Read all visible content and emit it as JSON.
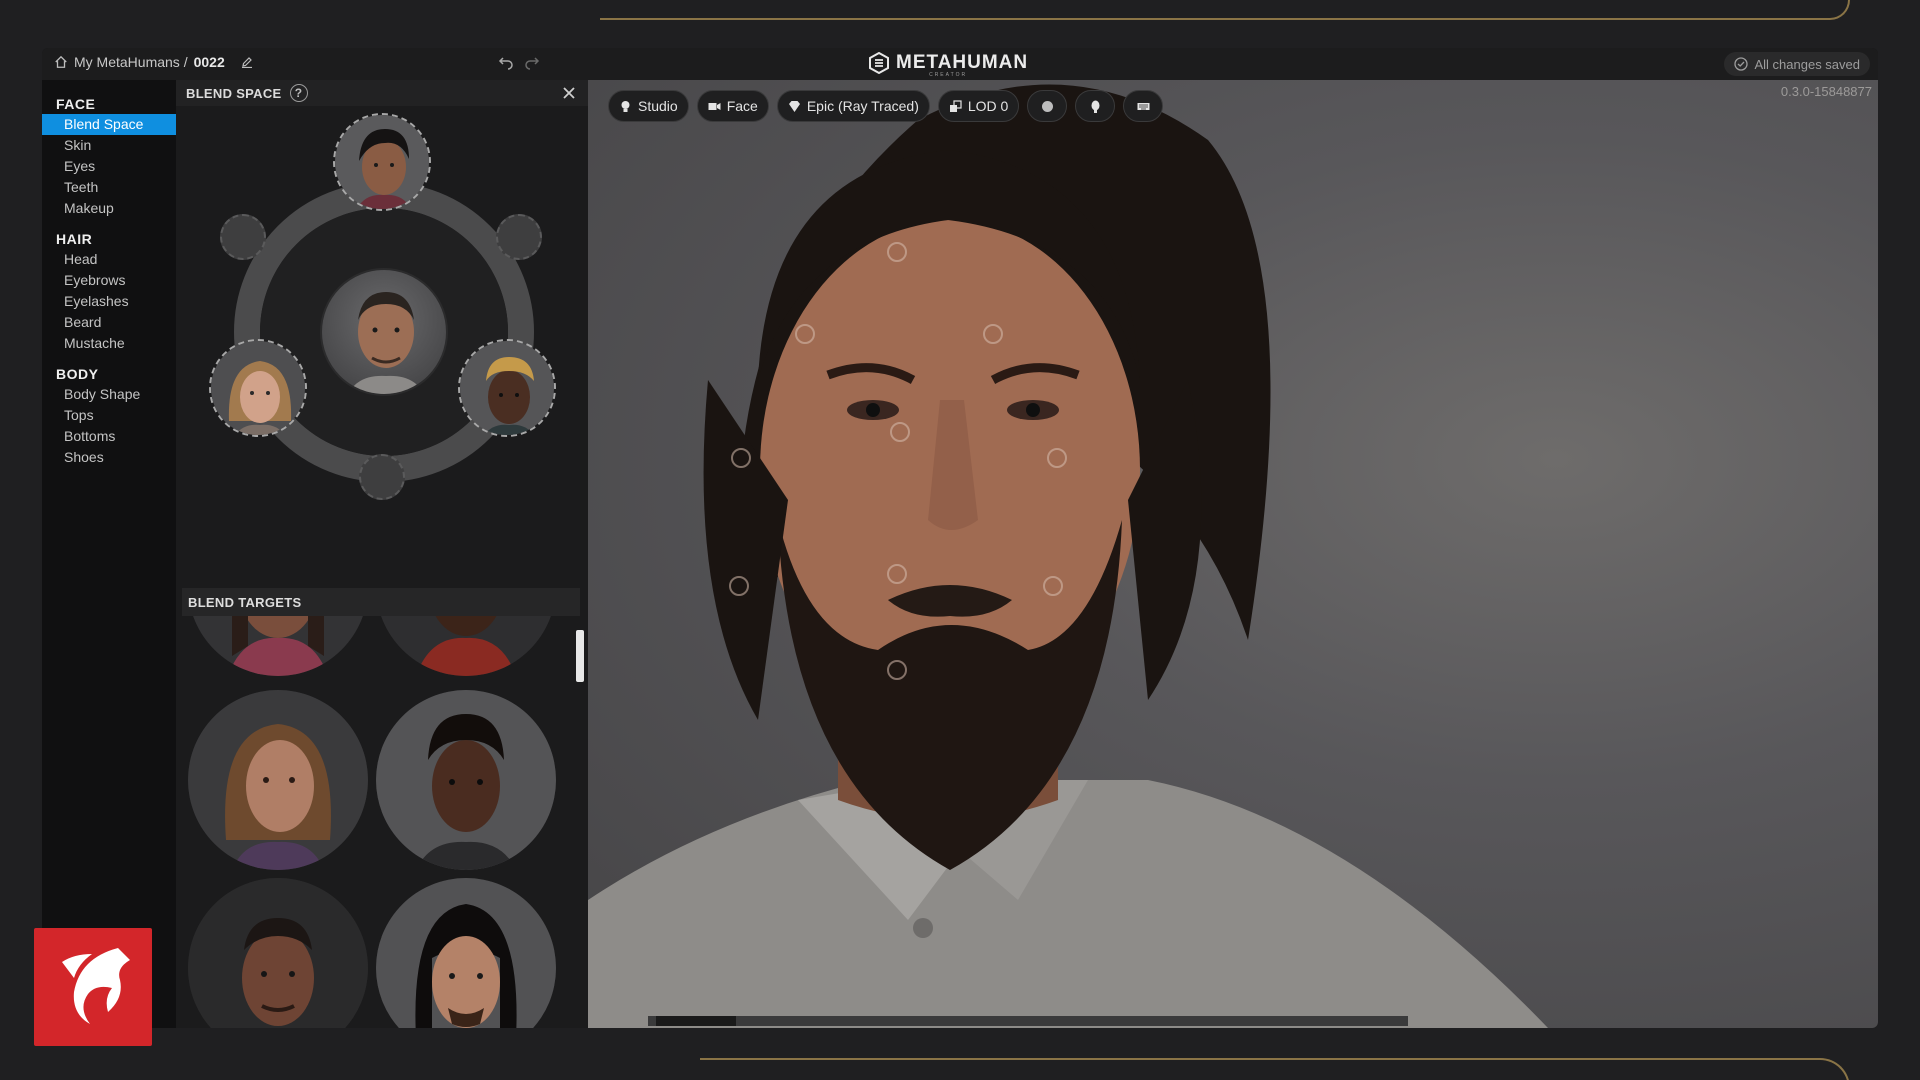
{
  "titlebar": {
    "breadcrumb_root": "My MetaHumans /",
    "breadcrumb_id": "0022",
    "logo_text": "METAHUMAN",
    "logo_sub": "CREATOR",
    "save_status": "All changes saved"
  },
  "nav": {
    "sections": [
      {
        "heading": "FACE",
        "items": [
          "Blend Space",
          "Skin",
          "Eyes",
          "Teeth",
          "Makeup"
        ]
      },
      {
        "heading": "HAIR",
        "items": [
          "Head",
          "Eyebrows",
          "Eyelashes",
          "Beard",
          "Mustache"
        ]
      },
      {
        "heading": "BODY",
        "items": [
          "Body Shape",
          "Tops",
          "Bottoms",
          "Shoes"
        ]
      }
    ],
    "active_item": "Blend Space"
  },
  "panel": {
    "title": "BLEND SPACE",
    "help_glyph": "?",
    "targets_title": "BLEND TARGETS"
  },
  "viewport": {
    "toolbar": {
      "studio": "Studio",
      "face": "Face",
      "quality": "Epic (Ray Traced)",
      "lod": "LOD 0"
    },
    "version": "0.3.0-15848877"
  },
  "colors": {
    "accent": "#0f8fe0",
    "brand_red": "#d3262a",
    "frame_gold": "#8a7446"
  }
}
